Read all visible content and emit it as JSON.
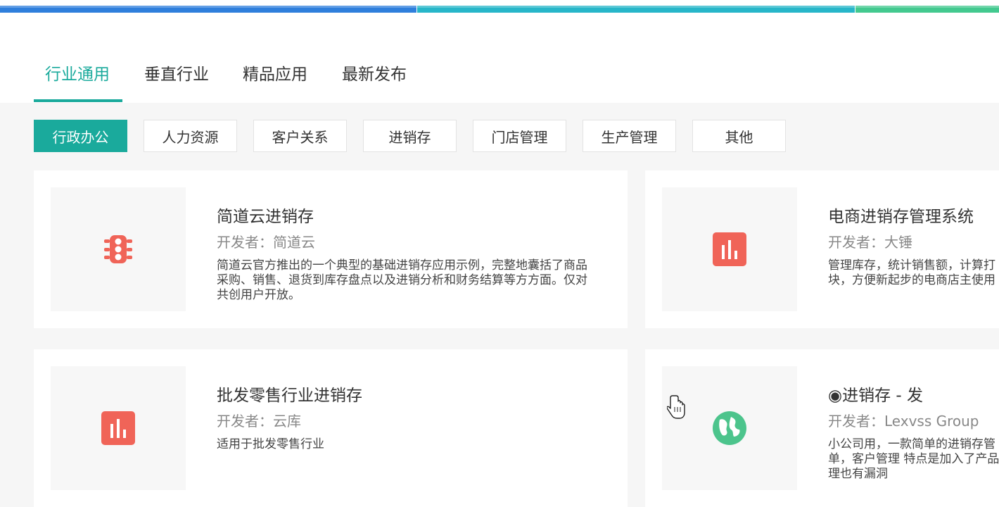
{
  "tabs": [
    {
      "label": "行业通用"
    },
    {
      "label": "垂直行业"
    },
    {
      "label": "精品应用"
    },
    {
      "label": "最新发布"
    }
  ],
  "filters": [
    {
      "label": "行政办公"
    },
    {
      "label": "人力资源"
    },
    {
      "label": "客户关系"
    },
    {
      "label": "进销存"
    },
    {
      "label": "门店管理"
    },
    {
      "label": "生产管理"
    },
    {
      "label": "其他"
    }
  ],
  "developer_prefix": "开发者：",
  "cards": [
    {
      "title": "简道云进销存",
      "developer": "简道云",
      "description": "简道云官方推出的一个典型的基础进销存应用示例，完整地囊括了商品采购、销售、退货到库存盘点以及进销分析和财务结算等方方面。仅对共创用户开放。",
      "icon": "traffic-light-icon",
      "icon_color": "#f06458"
    },
    {
      "title": "电商进销存管理系统",
      "developer": "大锤",
      "description": "管理库存，统计销售额，计算打块，方便新起步的电商店主使用",
      "icon": "bar-chart-icon",
      "icon_color": "#f06458"
    },
    {
      "title": "批发零售行业进销存",
      "developer": "云库",
      "description": "适用于批发零售行业",
      "icon": "bar-chart-icon",
      "icon_color": "#f06458"
    },
    {
      "title": "◉进销存 - 发",
      "developer": "Lexvss Group",
      "description": "小公司用，一款简单的进销存管单，客户管理 特点是加入了产品理也有漏洞",
      "icon": "globe-icon",
      "icon_color": "#4cc48c"
    }
  ],
  "colors": {
    "accent": "#1aaa9c",
    "icon_red": "#f06458",
    "icon_green": "#4cc48c"
  }
}
